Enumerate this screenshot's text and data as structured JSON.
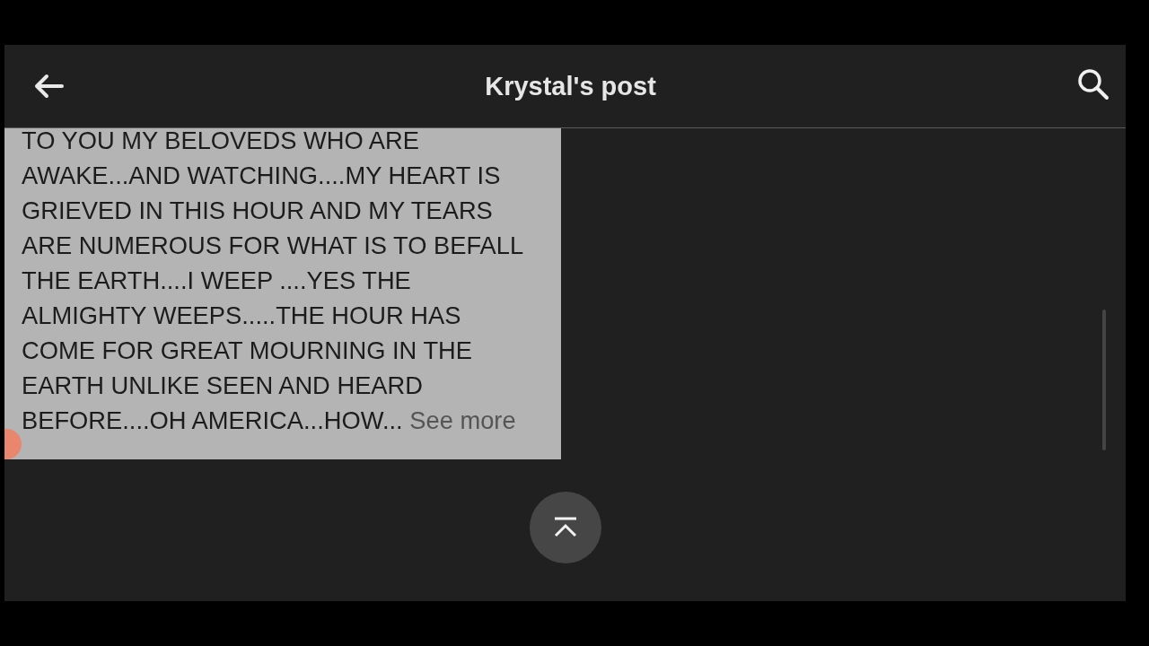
{
  "header": {
    "title": "Krystal's post"
  },
  "post": {
    "lines": [
      "TO YOU MY BELOVEDS WHO ARE",
      "AWAKE...AND WATCHING....MY HEART IS",
      "GRIEVED IN THIS HOUR AND MY TEARS",
      "ARE NUMEROUS FOR WHAT IS TO BEFALL",
      "THE EARTH....I WEEP ....YES THE",
      "ALMIGHTY WEEPS.....THE HOUR HAS",
      "COME FOR GREAT MOURNING IN THE",
      "EARTH UNLIKE SEEN AND HEARD",
      "BEFORE....OH AMERICA...HOW..."
    ],
    "see_more": "See more"
  }
}
